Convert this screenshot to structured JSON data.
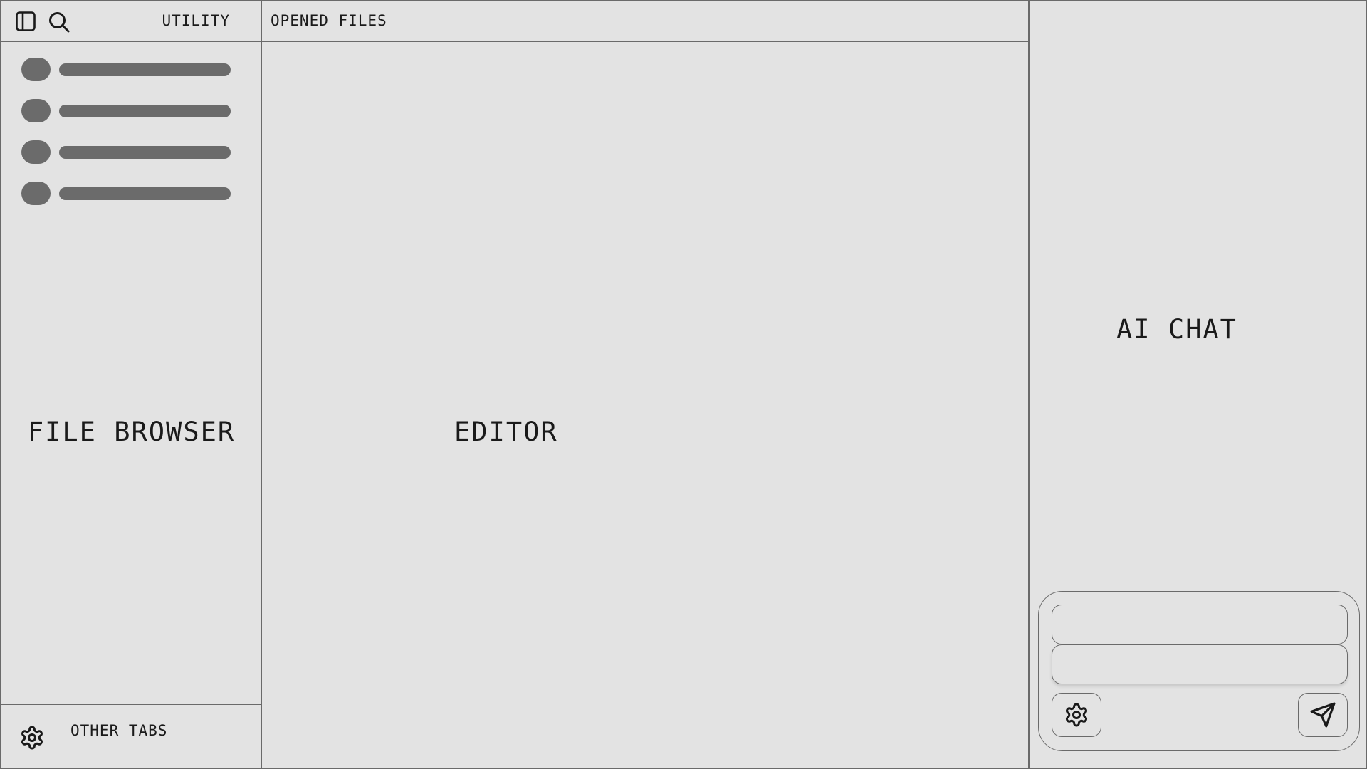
{
  "sidebar": {
    "toggle_icon": "sidebar-panel-icon",
    "search_icon": "search-icon",
    "utility_label": "UTILITY",
    "file_items": [
      {
        "icon": "file-placeholder"
      },
      {
        "icon": "file-placeholder"
      },
      {
        "icon": "file-placeholder"
      },
      {
        "icon": "file-placeholder"
      }
    ],
    "panel_label": "FILE BROWSER",
    "bottom": {
      "settings_icon": "gear-icon",
      "other_tabs_label": "OTHER TABS"
    }
  },
  "editor": {
    "tabs_label": "OPENED FILES",
    "panel_label": "EDITOR"
  },
  "chat": {
    "panel_label": "AI CHAT",
    "input_1": {
      "value": "",
      "placeholder": ""
    },
    "input_2": {
      "value": "",
      "placeholder": ""
    },
    "settings_icon": "gear-icon",
    "send_icon": "send-icon"
  },
  "colors": {
    "background": "#e3e3e3",
    "border": "#6a6a6a",
    "placeholder_fill": "#6b6b6b",
    "text": "#1a1a1a"
  }
}
